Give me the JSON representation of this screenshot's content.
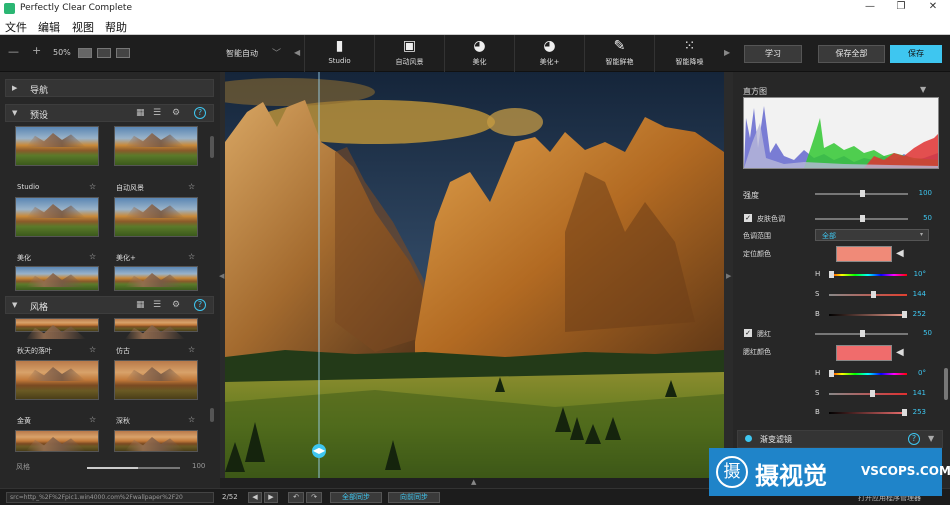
{
  "window": {
    "title": "Perfectly Clear Complete",
    "minimize": "—",
    "maximize": "❐",
    "close": "✕"
  },
  "menu": [
    "文件",
    "编辑",
    "视图",
    "帮助"
  ],
  "toolbar": {
    "zoom_out": "—",
    "zoom_in": "+",
    "zoom": "50%",
    "preset_select": "智能自动",
    "tools": [
      {
        "label": "Studio",
        "icon": "person-icon"
      },
      {
        "label": "自动风景",
        "icon": "landscape-icon"
      },
      {
        "label": "美化",
        "icon": "face-icon"
      },
      {
        "label": "美化+",
        "icon": "face-plus-icon"
      },
      {
        "label": "智能鲜艳",
        "icon": "brush-icon"
      },
      {
        "label": "智能降噪",
        "icon": "noise-icon"
      }
    ],
    "learn": "学习",
    "save_all": "保存全部",
    "save": "保存"
  },
  "left": {
    "nav_title": "导航",
    "presets_title": "预设",
    "presets": [
      {
        "label": "Studio"
      },
      {
        "label": "自动风景"
      },
      {
        "label": "美化"
      },
      {
        "label": "美化+"
      }
    ],
    "styles_title": "风格",
    "styles": [
      {
        "label": "秋天的落叶"
      },
      {
        "label": "仿古"
      },
      {
        "label": "金黄"
      },
      {
        "label": "深秋"
      }
    ],
    "style_strength_label": "风格",
    "style_strength_value": "100",
    "style_strength": 0.55
  },
  "right": {
    "histogram_title": "直方图",
    "strength": {
      "label": "强度",
      "value": "100",
      "level": 0.5
    },
    "skin_tone": {
      "label": "皮肤色调",
      "value": "50",
      "level": 0.5,
      "checked": "✓"
    },
    "tone_range": {
      "label": "色调范围",
      "value": "全部"
    },
    "target_color": {
      "label": "定位颜色",
      "swatch": "#f08a78"
    },
    "target_hsb": [
      {
        "label": "H",
        "value": "10°",
        "level": 0.03
      },
      {
        "label": "S",
        "value": "144",
        "level": 0.57
      },
      {
        "label": "B",
        "value": "252",
        "level": 0.99
      }
    ],
    "blush": {
      "label": "腮红",
      "value": "50",
      "level": 0.5,
      "checked": "✓"
    },
    "blush_color": {
      "label": "腮红颜色",
      "swatch": "#f06c6c"
    },
    "blush_hsb": [
      {
        "label": "H",
        "value": "0°",
        "level": 0.0
      },
      {
        "label": "S",
        "value": "141",
        "level": 0.55
      },
      {
        "label": "B",
        "value": "253",
        "level": 0.99
      }
    ],
    "gradient_filter": "渐变滤镜"
  },
  "statusbar": {
    "path": "src=http_%2F%2Fpic1.win4000.com%2Fwallpaper%2F20",
    "page": "2/52",
    "all_sync": "全部同步",
    "forward_sync": "向前同步",
    "open_manager": "打开应用程序管理器"
  },
  "watermark": {
    "logo": "摄",
    "cn": "摄视觉",
    "en": "VSCOPS.COM"
  }
}
